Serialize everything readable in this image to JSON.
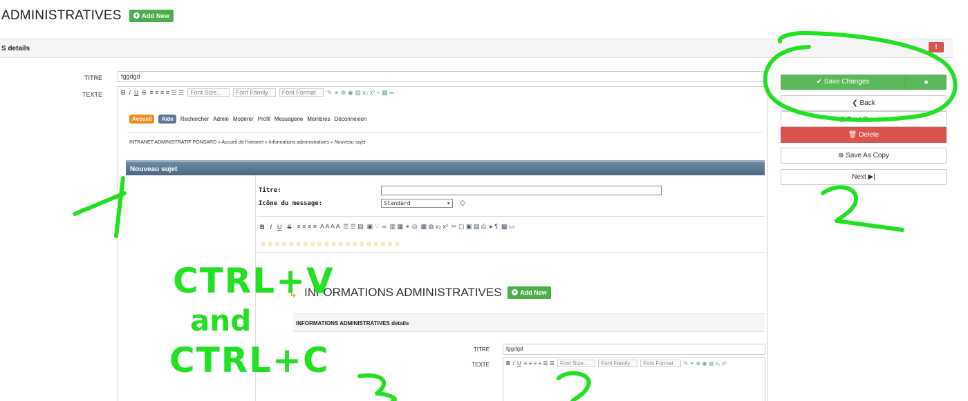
{
  "header": {
    "title": "ADMINISTRATIVES",
    "add_new": "Add New"
  },
  "panel": {
    "title": "S details",
    "badge": "!"
  },
  "fields": {
    "titre_label": "TITRE",
    "titre_value": "fggdgd",
    "texte_label": "TEXTE"
  },
  "editor_toolbar": {
    "items": [
      "B",
      "I",
      "U",
      "S"
    ],
    "font_size": "Font Size...",
    "font_family": "Font Family",
    "font_format": "Font Format"
  },
  "forum": {
    "nav": {
      "accueil": "Accueil",
      "aide": "Aide",
      "links": [
        "Rechercher",
        "Admin",
        "Modérer",
        "Profil",
        "Messagerie",
        "Membres",
        "Déconnexion"
      ]
    },
    "breadcrumb": "INTRANET ADMINISTRATIF PONSARD » Accueil de l'intranet » Informations administratives »",
    "breadcrumb_current": "Nouveau sujet",
    "section_title": "Nouveau sujet",
    "titre_label": "Titre:",
    "icone_label": "Icône du message:",
    "icone_value": "Standard",
    "format_buttons": [
      "B",
      "I",
      "U",
      "S"
    ]
  },
  "inner": {
    "title": "INFORMATIONS ADMINISTRATIVES",
    "add_new": "Add New",
    "panel_title": "INFORMATIONS ADMINISTRATIVES details",
    "titre_label": "TITRE",
    "titre_value": "fggdgd",
    "texte_label": "TEXTE",
    "font_size": "Font Size...",
    "font_family": "Font Family",
    "font_format": "Font Format"
  },
  "sidebar": {
    "save_changes": "Save Changes",
    "back": "Back",
    "print_preview": "Print Preview",
    "delete": "Delete",
    "save_as_copy": "Save As Copy",
    "next": "Next"
  },
  "annotations": {
    "text1": "CTRL+V",
    "text2": "and",
    "text3": "CTRL+C",
    "marks": [
      "1",
      "2",
      "3",
      "2"
    ],
    "color": "#22e022"
  }
}
